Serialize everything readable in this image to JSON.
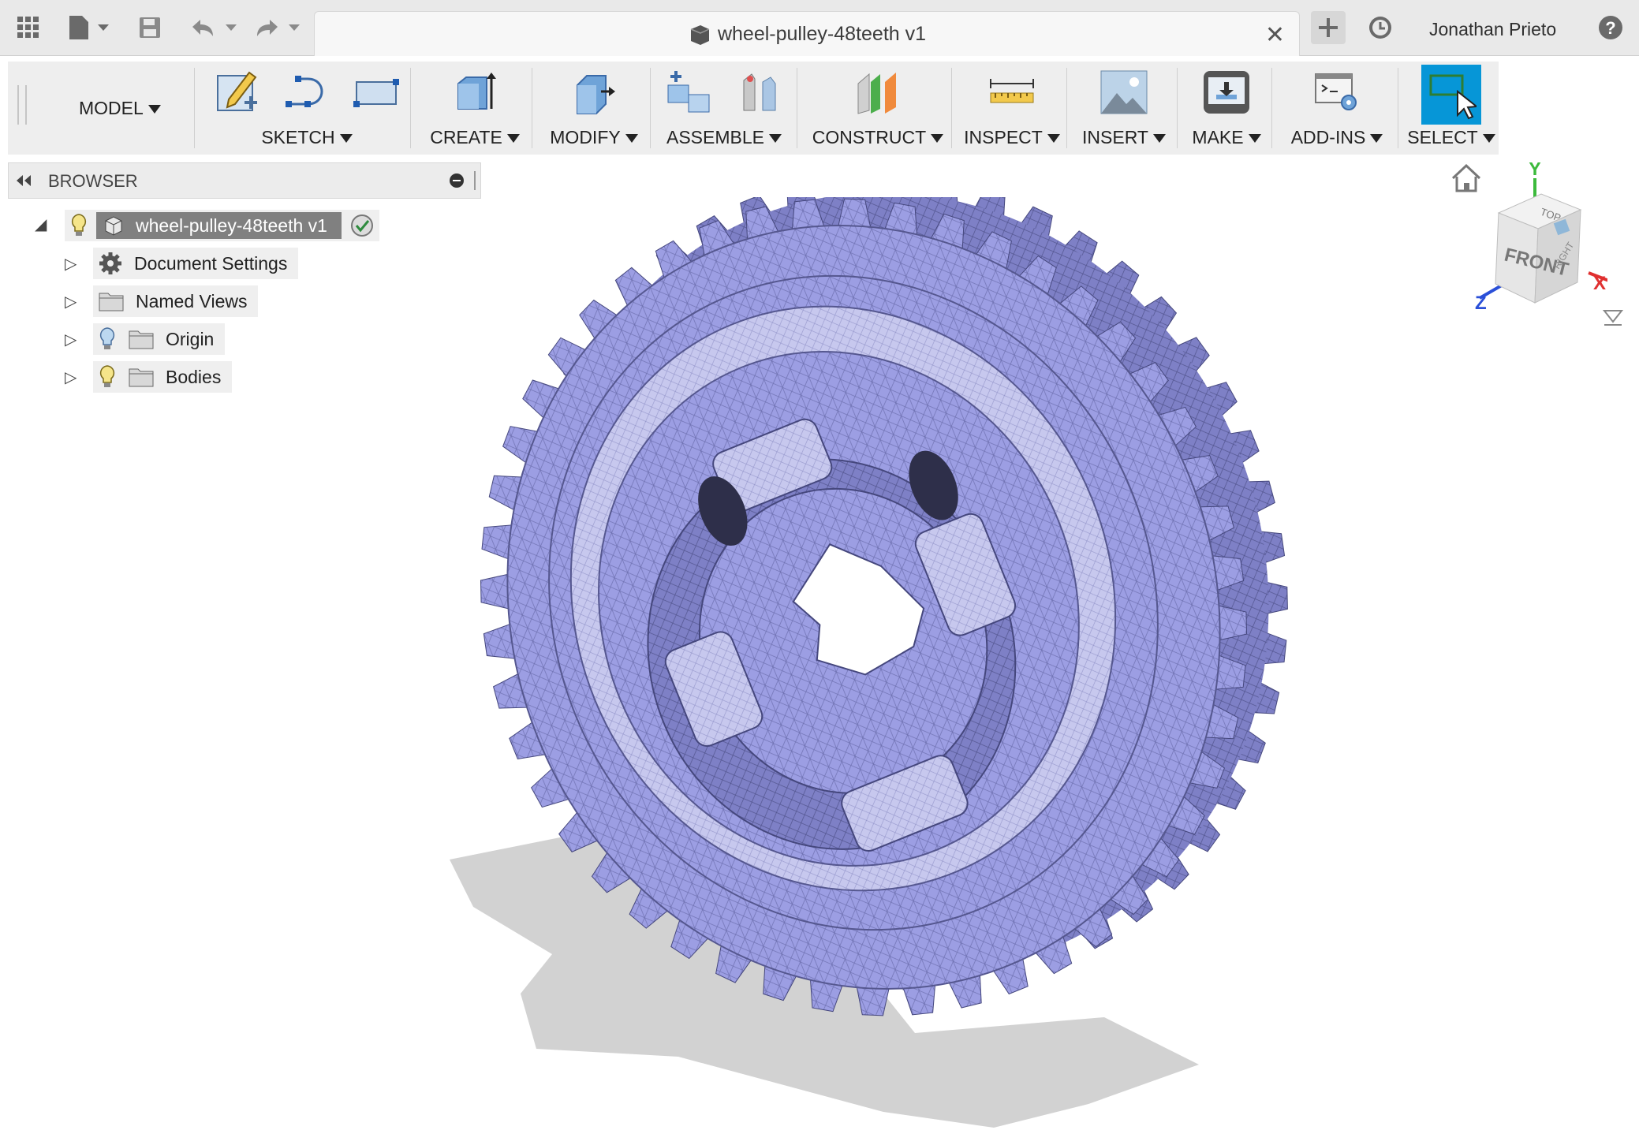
{
  "titlebar": {
    "document_title": "wheel-pulley-48teeth v1",
    "user_name": "Jonathan Prieto",
    "icons": [
      "apps-grid-icon",
      "file-icon",
      "save-icon",
      "undo-icon",
      "redo-icon",
      "close-icon",
      "new-tab-icon",
      "job-status-icon",
      "help-icon"
    ]
  },
  "toolbar": {
    "workspace": "MODEL",
    "groups": [
      {
        "label": "SKETCH"
      },
      {
        "label": "CREATE"
      },
      {
        "label": "MODIFY"
      },
      {
        "label": "ASSEMBLE"
      },
      {
        "label": "CONSTRUCT"
      },
      {
        "label": "INSPECT"
      },
      {
        "label": "INSERT"
      },
      {
        "label": "MAKE"
      },
      {
        "label": "ADD-INS"
      },
      {
        "label": "SELECT"
      }
    ],
    "select_color": "#0696d7"
  },
  "browser": {
    "title": "BROWSER",
    "root": {
      "label": "wheel-pulley-48teeth v1"
    },
    "items": [
      {
        "label": "Document Settings"
      },
      {
        "label": "Named Views"
      },
      {
        "label": "Origin"
      },
      {
        "label": "Bodies"
      }
    ]
  },
  "viewcube": {
    "front": "FRONT",
    "top": "TOP",
    "right": "RIGHT",
    "axis_x": "X",
    "axis_y": "Y",
    "axis_z": "Z"
  },
  "colors": {
    "mesh": "#9c9ee3",
    "mesh_dark": "#6466a8",
    "shadow": "#d4d4d4"
  }
}
